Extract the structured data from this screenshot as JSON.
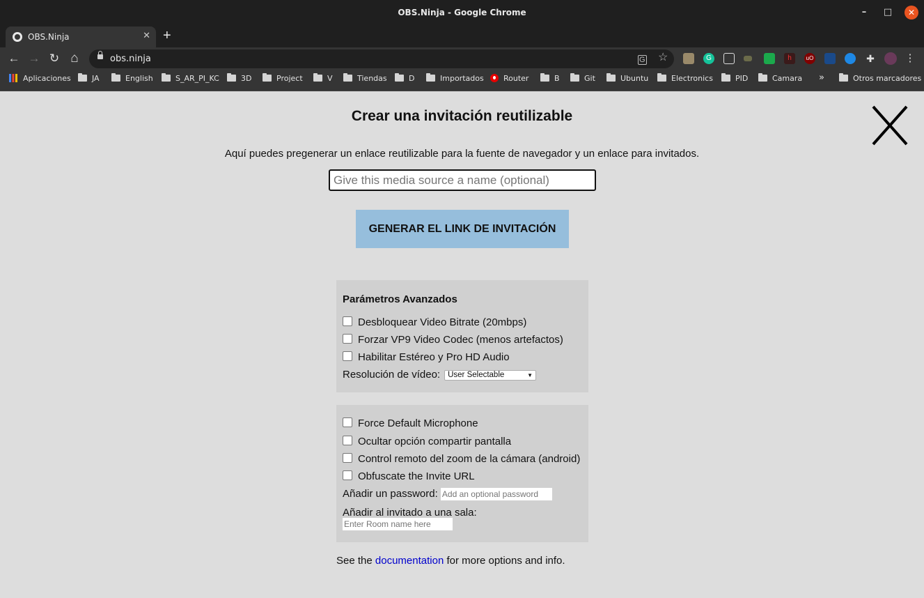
{
  "window": {
    "title": "OBS.Ninja - Google Chrome",
    "min_glyph": "–",
    "max_glyph": "□",
    "close_glyph": "✕"
  },
  "tab": {
    "label": "OBS.Ninja",
    "close_glyph": "✕"
  },
  "newtab_glyph": "+",
  "toolbar": {
    "back_glyph": "←",
    "forward_glyph": "→",
    "reload_glyph": "↻",
    "home_glyph": "⌂",
    "url": "obs.ninja",
    "star_glyph": "☆",
    "menu_glyph": "⋮"
  },
  "bookmarks": {
    "apps": "Aplicaciones",
    "items": [
      "JA",
      "English",
      "S_AR_PI_KC",
      "3D",
      "Project",
      "V",
      "Tiendas",
      "D",
      "Importados",
      "Router",
      "B",
      "Git",
      "Ubuntu",
      "Electronics",
      "PID",
      "Camara"
    ],
    "overflow": "»",
    "other": "Otros marcadores"
  },
  "dialog": {
    "heading": "Crear una invitación reutilizable",
    "description": "Aquí puedes pregenerar un enlace reutilizable para la fuente de navegador y un enlace para invitados.",
    "name_placeholder": "Give this media source a name (optional)",
    "generate_button": "GENERAR EL LINK DE INVITACIÓN",
    "advanced": {
      "title": "Parámetros Avanzados",
      "options": [
        "Desbloquear Video Bitrate (20mbps)",
        "Forzar VP9 Video Codec (menos artefactos)",
        "Habilitar Estéreo y Pro HD Audio"
      ],
      "resolution_label": "Resolución de vídeo:",
      "resolution_value": "User Selectable"
    },
    "more": {
      "options": [
        "Force Default Microphone",
        "Ocultar opción compartir pantalla",
        "Control remoto del zoom de la cámara (android)",
        "Obfuscate the Invite URL"
      ],
      "password_label": "Añadir un password:",
      "password_placeholder": "Add an optional password",
      "room_label": "Añadir al invitado a una sala:",
      "room_placeholder": "Enter Room name here"
    },
    "footer": {
      "before": "See the ",
      "link": "documentation",
      "after": " for more options and info."
    }
  }
}
